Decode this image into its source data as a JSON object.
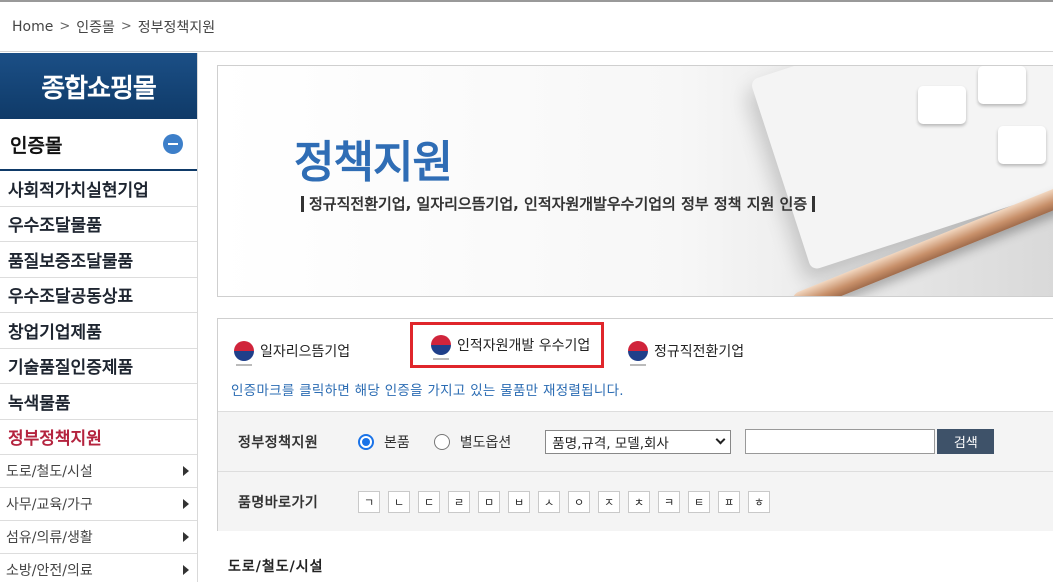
{
  "breadcrumb": {
    "items": [
      "Home",
      "인증몰",
      "정부정책지원"
    ],
    "separator": ">"
  },
  "sidebar": {
    "title": "종합쇼핑몰",
    "category": "인증몰",
    "items": [
      {
        "label": "사회적가치실현기업",
        "active": false
      },
      {
        "label": "우수조달물품",
        "active": false
      },
      {
        "label": "품질보증조달물품",
        "active": false
      },
      {
        "label": "우수조달공동상표",
        "active": false
      },
      {
        "label": "창업기업제품",
        "active": false
      },
      {
        "label": "기술품질인증제품",
        "active": false
      },
      {
        "label": "녹색물품",
        "active": false
      },
      {
        "label": "정부정책지원",
        "active": true
      }
    ],
    "subitems": [
      "도로/철도/시설",
      "사무/교육/가구",
      "섬유/의류/생활",
      "소방/안전/의료"
    ]
  },
  "banner": {
    "title": "정책지원",
    "subtitle": "정규직전환기업, 일자리으뜸기업, 인적자원개발우수기업의 정부 정책 지원 인증"
  },
  "certs": {
    "items": [
      "일자리으뜸기업",
      "인적자원개발 우수기업",
      "정규직전환기업"
    ],
    "selected_index": 1,
    "note": "인증마크를 클릭하면 해당 인증을 가지고 있는 물품만 재정렬됩니다."
  },
  "filter": {
    "label": "정부정책지원",
    "radio_main": "본품",
    "radio_option": "별도옵션",
    "select_value": "품명,규격, 모델,회사",
    "search_value": "",
    "search_button": "검색",
    "jump_label": "품명바로가기",
    "chars": [
      "ㄱ",
      "ㄴ",
      "ㄷ",
      "ㄹ",
      "ㅁ",
      "ㅂ",
      "ㅅ",
      "ㅇ",
      "ㅈ",
      "ㅊ",
      "ㅋ",
      "ㅌ",
      "ㅍ",
      "ㅎ"
    ]
  },
  "section": {
    "title": "도로/철도/시설"
  },
  "colors": {
    "accent": "#2f6db5",
    "sidebar_head": "#0f3a68",
    "active": "#b4233e",
    "highlight": "#e0262b"
  }
}
